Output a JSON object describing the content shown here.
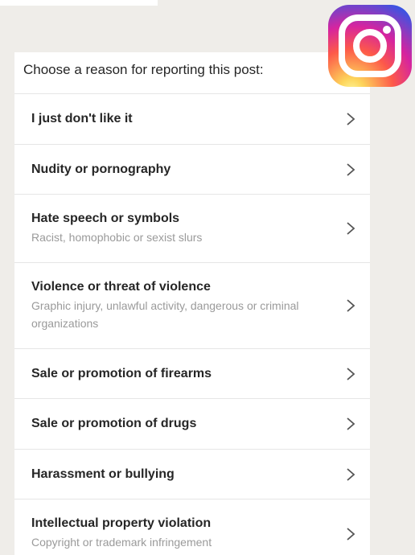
{
  "header": {
    "prompt": "Choose a reason for reporting this post:"
  },
  "reasons": [
    {
      "title": "I just don't like it",
      "subtitle": ""
    },
    {
      "title": "Nudity or pornography",
      "subtitle": ""
    },
    {
      "title": "Hate speech or symbols",
      "subtitle": "Racist, homophobic or sexist slurs"
    },
    {
      "title": "Violence or threat of violence",
      "subtitle": "Graphic injury, unlawful activity, dangerous or criminal organizations"
    },
    {
      "title": "Sale or promotion of firearms",
      "subtitle": ""
    },
    {
      "title": "Sale or promotion of drugs",
      "subtitle": ""
    },
    {
      "title": "Harassment or bullying",
      "subtitle": ""
    },
    {
      "title": "Intellectual property violation",
      "subtitle": "Copyright or trademark infringement"
    }
  ],
  "icons": {
    "row_arrow": "chevron-right-icon",
    "logo": "instagram-logo-icon"
  },
  "colors": {
    "background": "#efede9",
    "panel": "#ffffff",
    "title_text": "#262626",
    "subtitle_text": "#9a9a9a",
    "divider": "#e6e6e6"
  }
}
